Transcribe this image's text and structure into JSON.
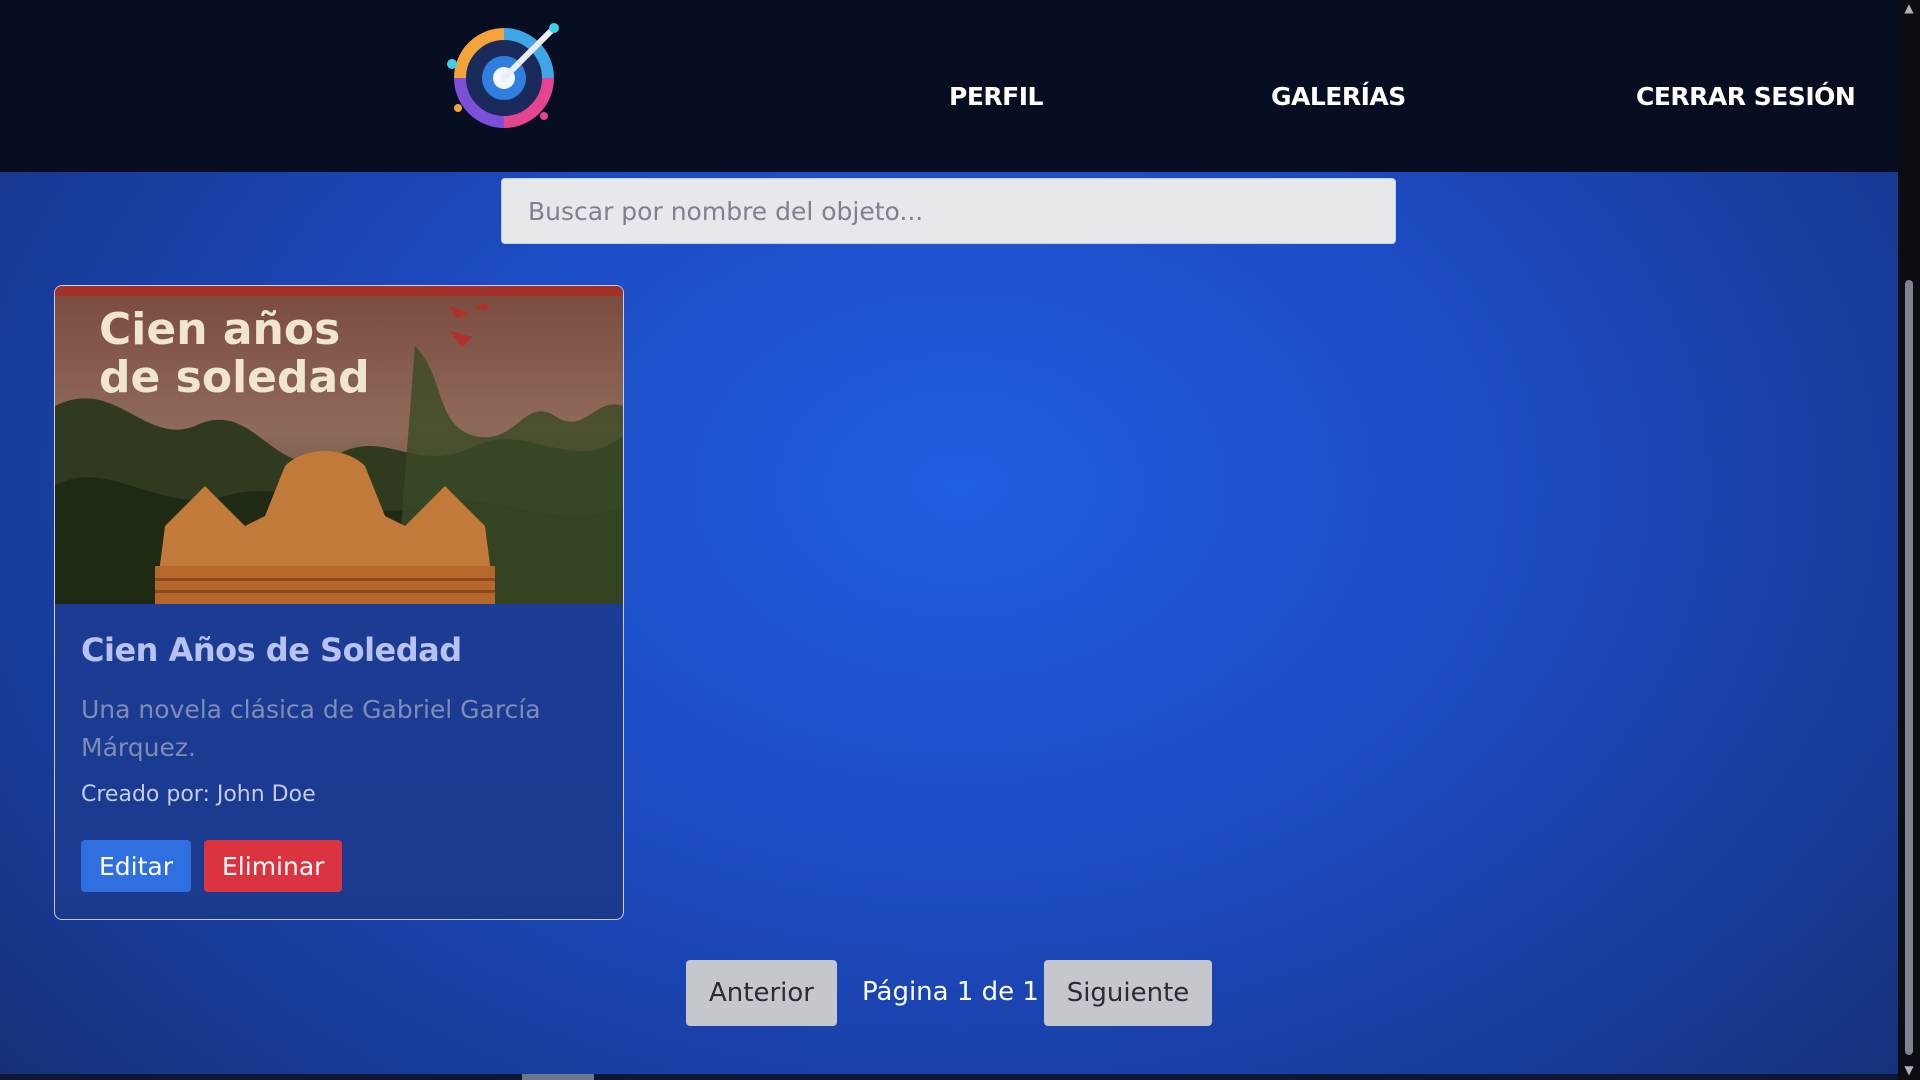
{
  "nav": {
    "logo_icon": "palette-brush-icon",
    "links": [
      {
        "label": "PERFIL"
      },
      {
        "label": "GALERÍAS"
      },
      {
        "label": "CERRAR SESIÓN"
      }
    ]
  },
  "search": {
    "placeholder": "Buscar por nombre del objeto...",
    "value": ""
  },
  "items": [
    {
      "image_icon": "book-cover-image",
      "image_text_line1": "Cien años",
      "image_text_line2": "de soledad",
      "title": "Cien Años de Soledad",
      "description": "Una novela clásica de Gabriel García Márquez.",
      "creator": "Creado por: John Doe",
      "edit_label": "Editar",
      "delete_label": "Eliminar"
    }
  ],
  "pagination": {
    "prev_label": "Anterior",
    "info": "Página 1 de 1",
    "next_label": "Siguiente"
  },
  "colors": {
    "navbar": "#070e22",
    "background": "#1d4bc3",
    "edit_button": "#2f6fe0",
    "delete_button": "#dc3340",
    "pager_button": "#c5c7cd"
  }
}
